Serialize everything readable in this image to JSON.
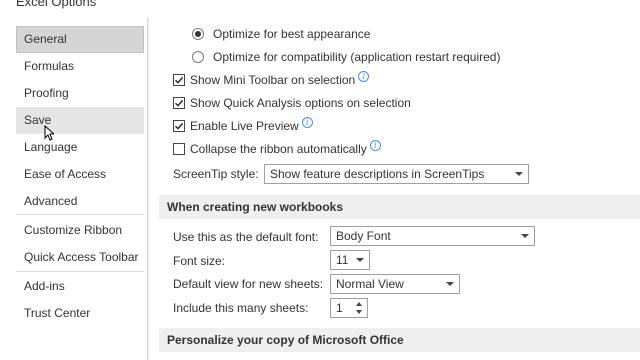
{
  "window": {
    "title": "Excel Options"
  },
  "sidebar": {
    "items": [
      {
        "label": "General"
      },
      {
        "label": "Formulas"
      },
      {
        "label": "Proofing"
      },
      {
        "label": "Save"
      },
      {
        "label": "Language"
      },
      {
        "label": "Ease of Access"
      },
      {
        "label": "Advanced"
      },
      {
        "label": "Customize Ribbon"
      },
      {
        "label": "Quick Access Toolbar"
      },
      {
        "label": "Add-ins"
      },
      {
        "label": "Trust Center"
      }
    ]
  },
  "ui_options": {
    "optimize_appearance": {
      "label": "Optimize for best appearance",
      "checked": true
    },
    "optimize_compat": {
      "label": "Optimize for compatibility (application restart required)",
      "checked": false
    },
    "mini_toolbar": {
      "label": "Show Mini Toolbar on selection",
      "checked": true
    },
    "quick_analysis": {
      "label": "Show Quick Analysis options on selection",
      "checked": true
    },
    "live_preview": {
      "label": "Enable Live Preview",
      "checked": true
    },
    "collapse_ribbon": {
      "label": "Collapse the ribbon automatically",
      "checked": false
    },
    "screentip": {
      "label": "ScreenTip style:",
      "value": "Show feature descriptions in ScreenTips"
    }
  },
  "new_workbooks": {
    "header": "When creating new workbooks",
    "default_font": {
      "label": "Use this as the default font:",
      "value": "Body Font"
    },
    "font_size": {
      "label": "Font size:",
      "value": "11"
    },
    "default_view": {
      "label": "Default view for new sheets:",
      "value": "Normal View"
    },
    "sheets": {
      "label": "Include this many sheets:",
      "value": "1"
    }
  },
  "personalize": {
    "header": "Personalize your copy of Microsoft Office"
  },
  "icons": {
    "info": "info-icon",
    "check": "checkmark-icon",
    "dropdown": "chevron-down-icon",
    "cursor": "mouse-pointer-icon"
  }
}
